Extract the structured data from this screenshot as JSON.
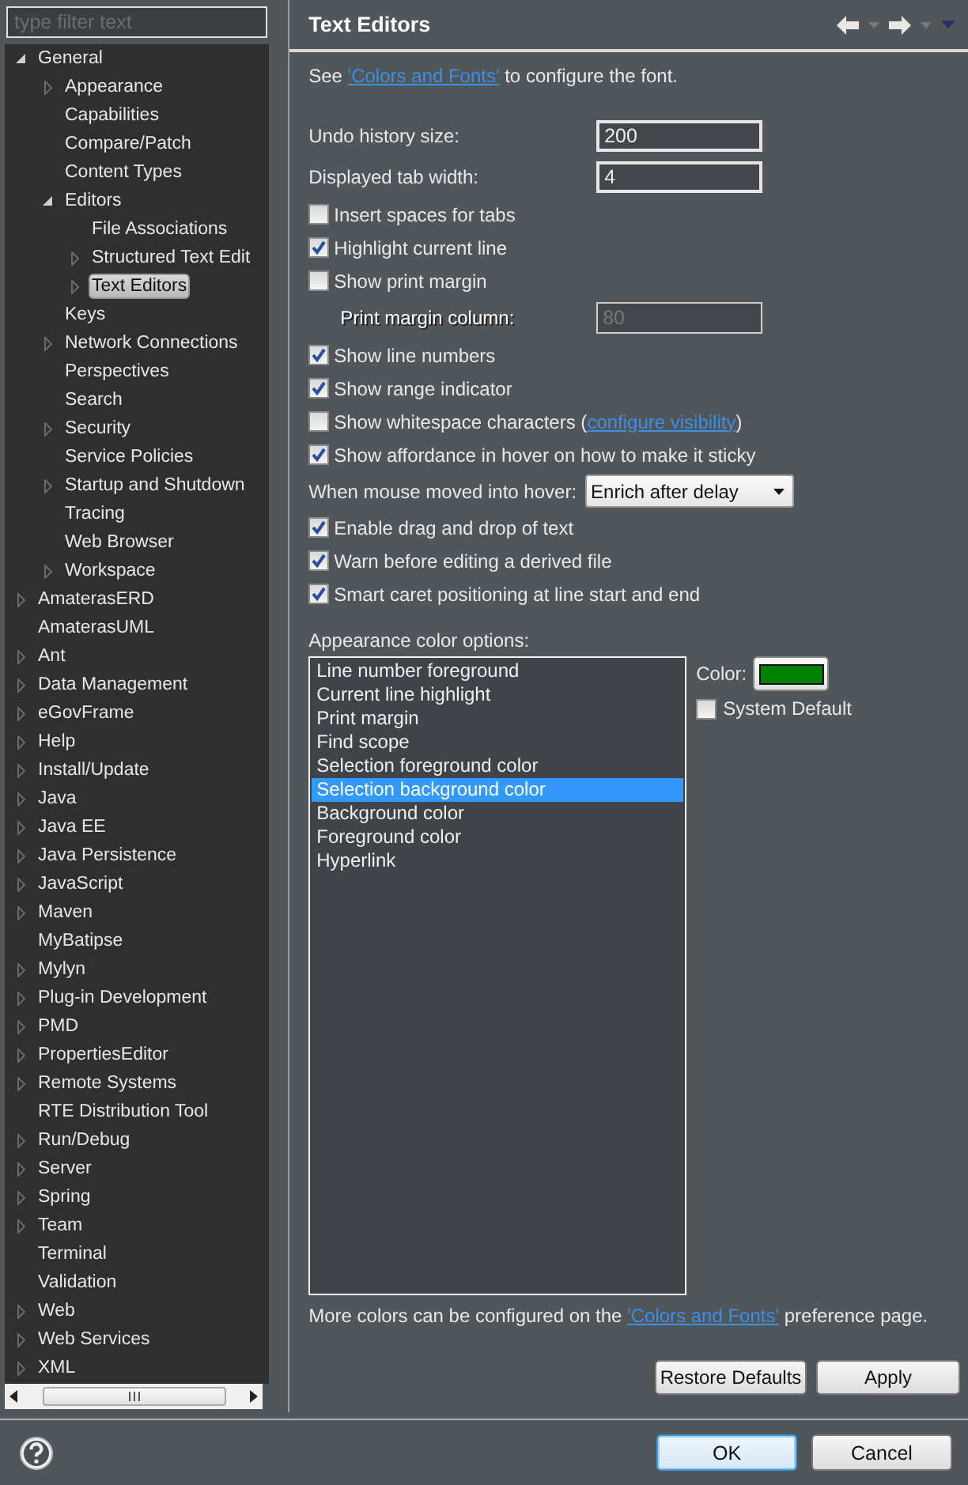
{
  "filter": {
    "placeholder": "type filter text"
  },
  "tree": [
    {
      "label": "General",
      "expanded": true,
      "selected": false,
      "children": [
        {
          "label": "Appearance",
          "expanded": false,
          "selected": false
        },
        {
          "label": "Capabilities",
          "selected": false
        },
        {
          "label": "Compare/Patch",
          "selected": false
        },
        {
          "label": "Content Types",
          "selected": false
        },
        {
          "label": "Editors",
          "expanded": true,
          "selected": false,
          "children": [
            {
              "label": "File Associations",
              "selected": false
            },
            {
              "label": "Structured Text Edit",
              "expanded": false,
              "selected": false
            },
            {
              "label": "Text Editors",
              "expanded": false,
              "selected": true
            }
          ]
        },
        {
          "label": "Keys",
          "selected": false
        },
        {
          "label": "Network Connections",
          "expanded": false,
          "selected": false
        },
        {
          "label": "Perspectives",
          "selected": false
        },
        {
          "label": "Search",
          "selected": false
        },
        {
          "label": "Security",
          "expanded": false,
          "selected": false
        },
        {
          "label": "Service Policies",
          "selected": false
        },
        {
          "label": "Startup and Shutdown",
          "expanded": false,
          "selected": false
        },
        {
          "label": "Tracing",
          "selected": false
        },
        {
          "label": "Web Browser",
          "selected": false
        },
        {
          "label": "Workspace",
          "expanded": false,
          "selected": false
        }
      ]
    },
    {
      "label": "AmaterasERD",
      "expanded": false,
      "selected": false
    },
    {
      "label": "AmaterasUML",
      "selected": false
    },
    {
      "label": "Ant",
      "expanded": false,
      "selected": false
    },
    {
      "label": "Data Management",
      "expanded": false,
      "selected": false
    },
    {
      "label": "eGovFrame",
      "expanded": false,
      "selected": false
    },
    {
      "label": "Help",
      "expanded": false,
      "selected": false
    },
    {
      "label": "Install/Update",
      "expanded": false,
      "selected": false
    },
    {
      "label": "Java",
      "expanded": false,
      "selected": false
    },
    {
      "label": "Java EE",
      "expanded": false,
      "selected": false
    },
    {
      "label": "Java Persistence",
      "expanded": false,
      "selected": false
    },
    {
      "label": "JavaScript",
      "expanded": false,
      "selected": false
    },
    {
      "label": "Maven",
      "expanded": false,
      "selected": false
    },
    {
      "label": "MyBatipse",
      "selected": false
    },
    {
      "label": "Mylyn",
      "expanded": false,
      "selected": false
    },
    {
      "label": "Plug-in Development",
      "expanded": false,
      "selected": false
    },
    {
      "label": "PMD",
      "expanded": false,
      "selected": false
    },
    {
      "label": "PropertiesEditor",
      "expanded": false,
      "selected": false
    },
    {
      "label": "Remote Systems",
      "expanded": false,
      "selected": false
    },
    {
      "label": "RTE Distribution Tool",
      "selected": false
    },
    {
      "label": "Run/Debug",
      "expanded": false,
      "selected": false
    },
    {
      "label": "Server",
      "expanded": false,
      "selected": false
    },
    {
      "label": "Spring",
      "expanded": false,
      "selected": false
    },
    {
      "label": "Team",
      "expanded": false,
      "selected": false
    },
    {
      "label": "Terminal",
      "selected": false
    },
    {
      "label": "Validation",
      "selected": false
    },
    {
      "label": "Web",
      "expanded": false,
      "selected": false
    },
    {
      "label": "Web Services",
      "expanded": false,
      "selected": false
    },
    {
      "label": "XML",
      "expanded": false,
      "selected": false
    }
  ],
  "page": {
    "title": "Text Editors",
    "intro": {
      "before": "See ",
      "link": "'Colors and Fonts'",
      "after": " to configure the font."
    },
    "settings": [
      {
        "kind": "field",
        "label": "Undo history size:",
        "value": "200",
        "disabled": false
      },
      {
        "kind": "field",
        "label": "Displayed tab width:",
        "value": "4",
        "disabled": false
      },
      {
        "kind": "checkbox",
        "label": "Insert spaces for tabs",
        "checked": false
      },
      {
        "kind": "checkbox",
        "label": "Highlight current line",
        "checked": true
      },
      {
        "kind": "checkbox",
        "label": "Show print margin",
        "checked": false
      },
      {
        "kind": "field",
        "label": "Print margin column:",
        "value": "80",
        "disabled": true
      },
      {
        "kind": "checkbox",
        "label": "Show line numbers",
        "checked": true
      },
      {
        "kind": "checkbox",
        "label": "Show range indicator",
        "checked": true
      },
      {
        "kind": "checkbox",
        "label": "Show whitespace characters (",
        "link": "configure visibility",
        "suffix": ")",
        "checked": false
      },
      {
        "kind": "checkbox",
        "label": "Show affordance in hover on how to make it sticky",
        "checked": true
      },
      {
        "kind": "dropdown",
        "label": "When mouse moved into hover:",
        "value": "Enrich after delay"
      },
      {
        "kind": "checkbox",
        "label": "Enable drag and drop of text",
        "checked": true
      },
      {
        "kind": "checkbox",
        "label": "Warn before editing a derived file",
        "checked": true
      },
      {
        "kind": "checkbox",
        "label": "Smart caret positioning at line start and end",
        "checked": true
      }
    ],
    "color_options": {
      "label": "Appearance color options:",
      "items": [
        {
          "label": "Line number foreground",
          "selected": false
        },
        {
          "label": "Current line highlight",
          "selected": false
        },
        {
          "label": "Print margin",
          "selected": false
        },
        {
          "label": "Find scope",
          "selected": false
        },
        {
          "label": "Selection foreground color",
          "selected": false
        },
        {
          "label": "Selection background color",
          "selected": true
        },
        {
          "label": "Background color",
          "selected": false
        },
        {
          "label": "Foreground color",
          "selected": false
        },
        {
          "label": "Hyperlink",
          "selected": false
        }
      ],
      "color_label": "Color:",
      "color": "#008000",
      "system_default": {
        "label": "System Default",
        "checked": false
      }
    },
    "note": {
      "before": "More colors can be configured on the ",
      "link": "'Colors and Fonts'",
      "after": " preference page."
    },
    "buttons": [
      "Restore Defaults",
      "Apply"
    ]
  },
  "dialog_buttons": [
    {
      "label": "OK",
      "default": true
    },
    {
      "label": "Cancel",
      "default": false
    }
  ]
}
